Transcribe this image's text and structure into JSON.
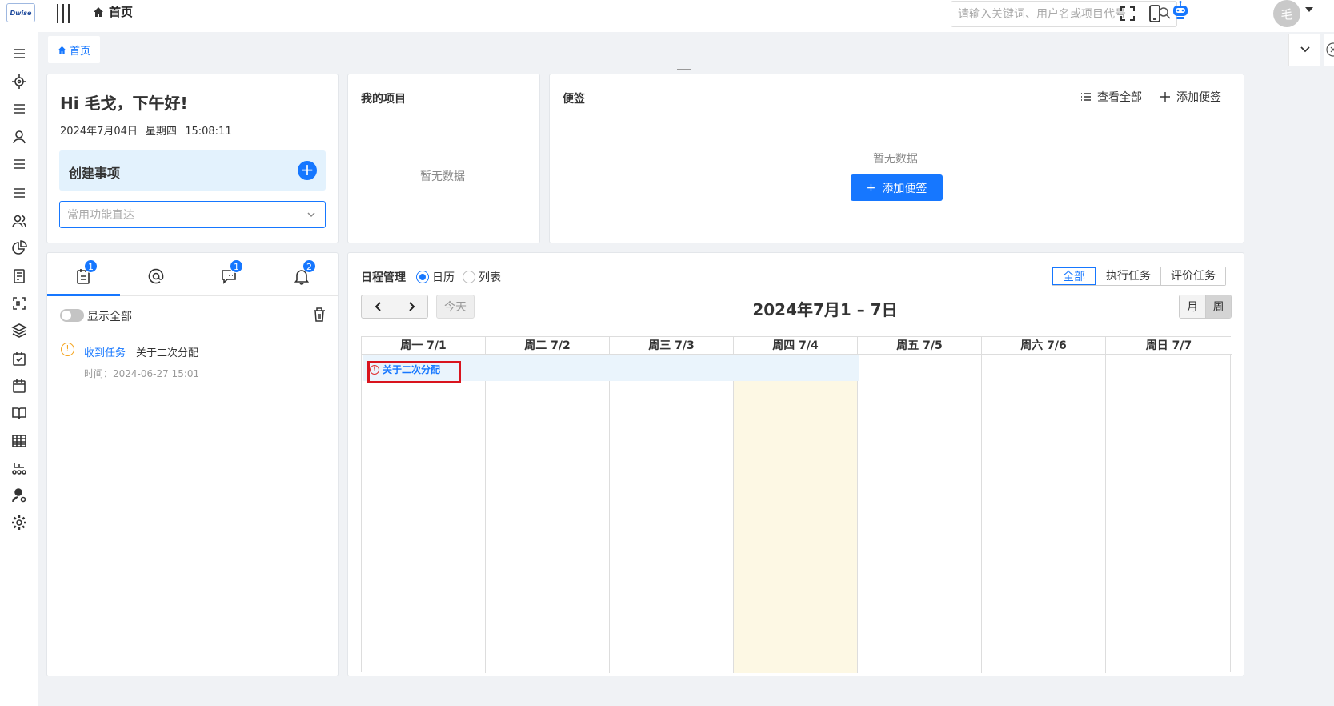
{
  "app": {
    "logo_text": "Dwise"
  },
  "header": {
    "breadcrumb": "首页",
    "search_placeholder": "请输入关键词、用户名或项目代号",
    "avatar_text": "毛"
  },
  "tabs": {
    "home_label": "首页"
  },
  "welcome": {
    "greeting": "Hi 毛戈，下午好!",
    "date": "2024年7月04日",
    "weekday": "星期四",
    "time": "15:08:11",
    "create_label": "创建事项",
    "quick_placeholder": "常用功能直达"
  },
  "projects": {
    "title": "我的项目",
    "empty": "暂无数据"
  },
  "notes": {
    "title": "便签",
    "view_all": "查看全部",
    "add": "添加便签",
    "empty": "暂无数据",
    "add_button": "添加便签"
  },
  "messages": {
    "tabs": [
      {
        "icon": "task-list-icon",
        "badge": "1"
      },
      {
        "icon": "at-icon",
        "badge": ""
      },
      {
        "icon": "chat-icon",
        "badge": "1"
      },
      {
        "icon": "bell-icon",
        "badge": "2"
      }
    ],
    "show_all": "显示全部",
    "item": {
      "type": "收到任务",
      "text": "关于二次分配",
      "time": "时间：2024-06-27 15:01"
    }
  },
  "schedule": {
    "title": "日程管理",
    "mode_calendar": "日历",
    "mode_list": "列表",
    "filters": [
      "全部",
      "执行任务",
      "评价任务"
    ],
    "today_btn": "今天",
    "week_title": "2024年7月1 – 7日",
    "view_month": "月",
    "view_week": "周",
    "days": [
      "周一 7/1",
      "周二 7/2",
      "周三 7/3",
      "周四 7/4",
      "周五 7/5",
      "周六 7/6",
      "周日 7/7"
    ],
    "event": "关于二次分配"
  },
  "colors": {
    "accent": "#1677ff",
    "today_bg": "#fdf8e4",
    "highlight": "#d9141e",
    "warn": "#f5a623"
  }
}
